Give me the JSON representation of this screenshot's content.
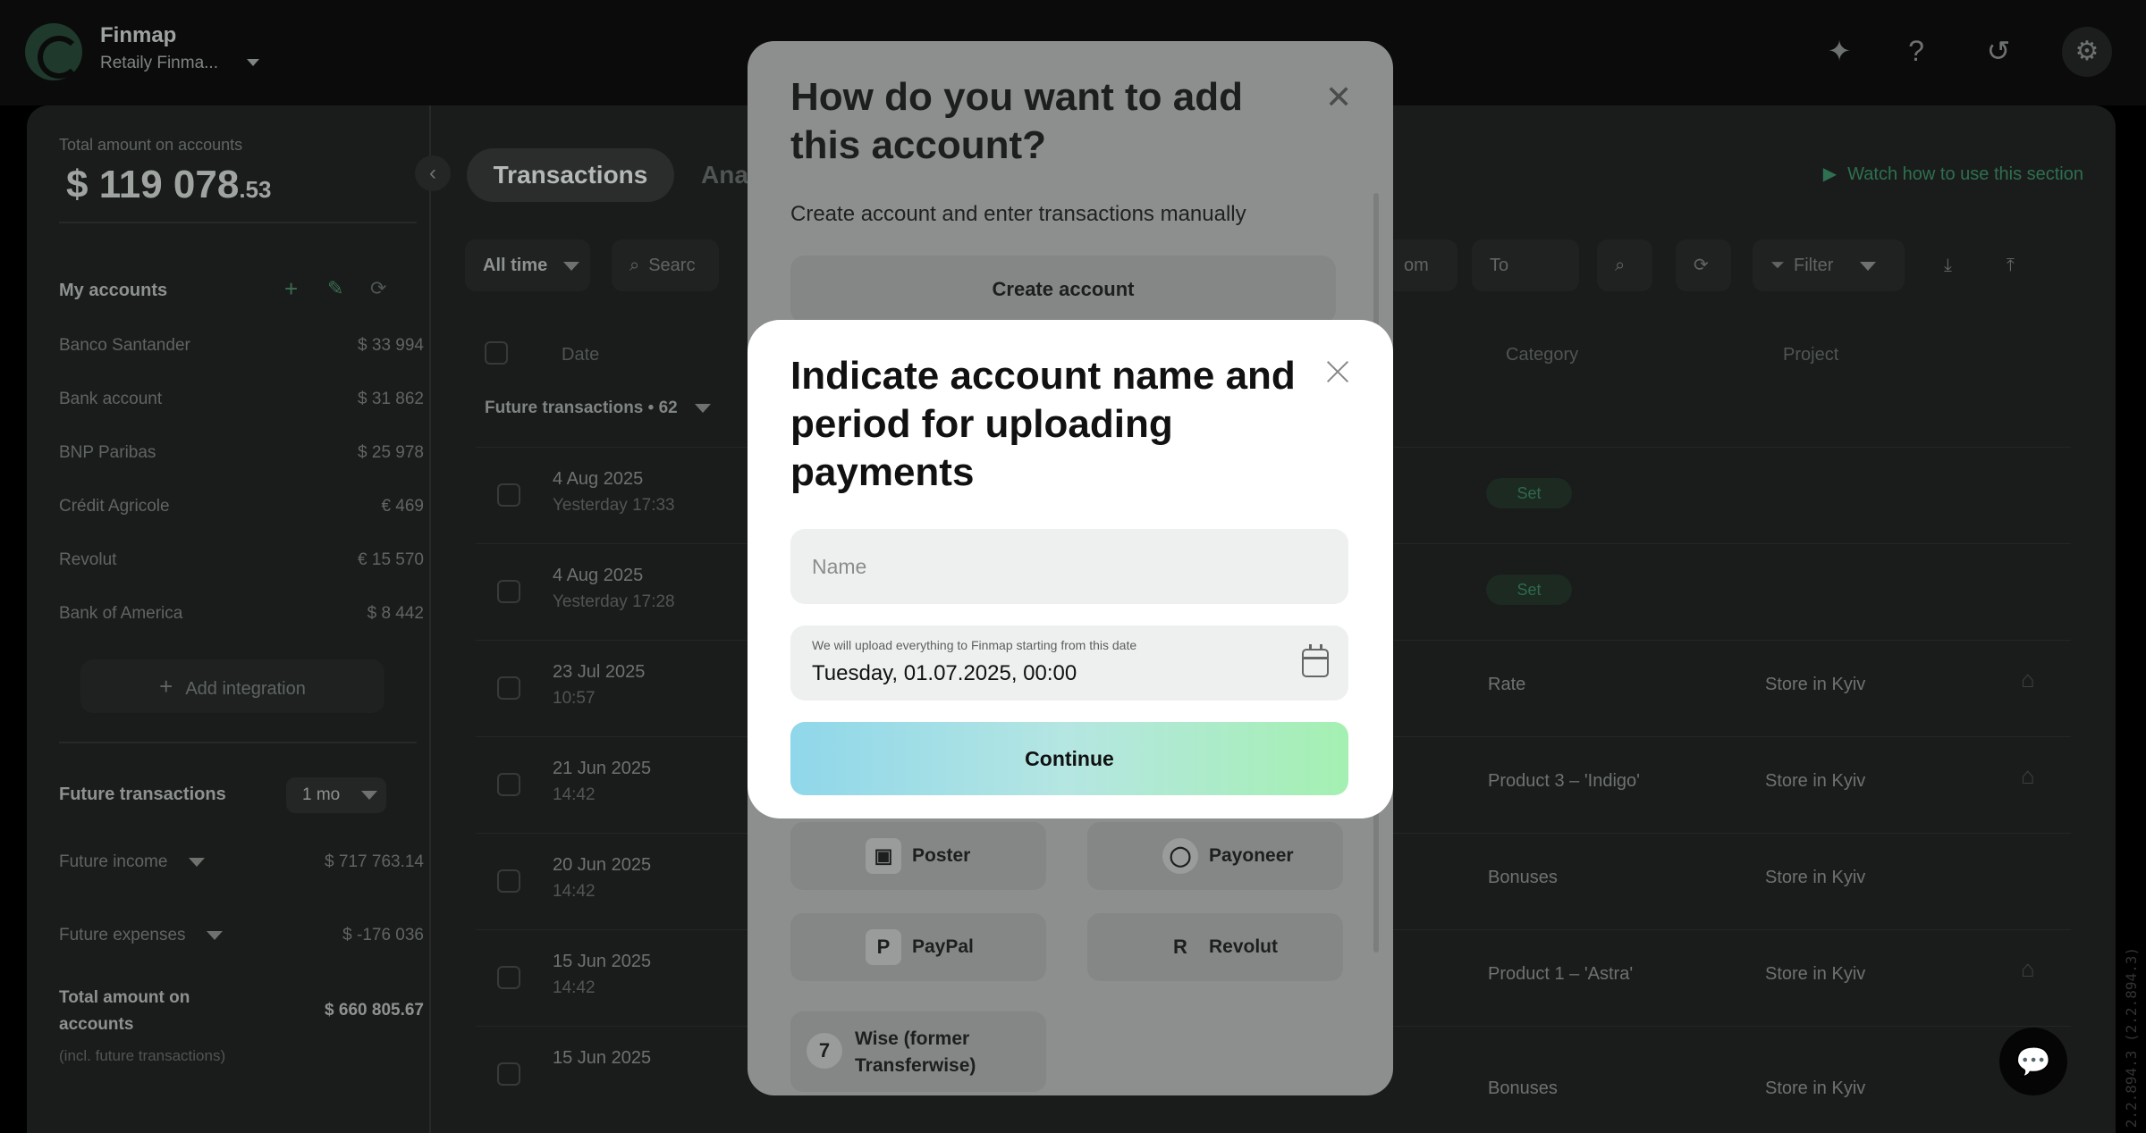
{
  "app": {
    "name": "Finmap",
    "company": "Retaily Finma..."
  },
  "sidebar": {
    "total_label": "Total amount on accounts",
    "total_main": "$ 119 078",
    "total_cents": ".53",
    "accounts_title": "My accounts",
    "accounts": [
      {
        "name": "Banco Santander",
        "amount": "$ 33 994"
      },
      {
        "name": "Bank account",
        "amount": "$ 31 862"
      },
      {
        "name": "BNP Paribas",
        "amount": "$ 25 978"
      },
      {
        "name": "Crédit Agricole",
        "amount": "€ 469"
      },
      {
        "name": "Revolut",
        "amount": "€ 15 570"
      },
      {
        "name": "Bank of America",
        "amount": "$ 8 442"
      }
    ],
    "add_integration": "Add integration",
    "future_title": "Future transactions",
    "future_period": "1 mo",
    "future_income_label": "Future income",
    "future_income_value": "$ 717 763.14",
    "future_expenses_label": "Future expenses",
    "future_expenses_value": "$ -176 036",
    "grand_label": "Total amount on accounts",
    "grand_value": "$ 660 805.67",
    "grand_note": "(incl. future transactions)"
  },
  "main": {
    "tab_active": "Transactions",
    "tab_other": "Ana",
    "watch_label": "Watch how to use this section",
    "period": "All time",
    "search_placeholder": "Searc",
    "from_placeholder": "om",
    "to_placeholder": "To",
    "filter_label": "Filter",
    "headers": {
      "date": "Date",
      "category": "Category",
      "project": "Project"
    },
    "group_label": "Future transactions • 62",
    "rows": [
      {
        "date": "4 Aug 2025",
        "time": "Yesterday 17:33",
        "category": "",
        "project": "",
        "set": "Set"
      },
      {
        "date": "4 Aug 2025",
        "time": "Yesterday 17:28",
        "category": "",
        "project": "",
        "set": "Set"
      },
      {
        "date": "23 Jul 2025",
        "time": "10:57",
        "category": "Rate",
        "project": "Store in Kyiv",
        "set": ""
      },
      {
        "date": "21 Jun 2025",
        "time": "14:42",
        "category": "Product 3 – 'Indigo'",
        "project": "Store in Kyiv",
        "set": ""
      },
      {
        "date": "20 Jun 2025",
        "time": "14:42",
        "category": "Bonuses",
        "project": "Store in Kyiv",
        "set": ""
      },
      {
        "date": "15 Jun 2025",
        "time": "14:42",
        "category": "Product 1 – 'Astra'",
        "project": "Store in Kyiv",
        "set": ""
      },
      {
        "date": "15 Jun 2025",
        "time": "",
        "category": "Bonuses",
        "project": "Store in Kyiv",
        "set": ""
      }
    ]
  },
  "side_code": "2.2.894.3 (2.2.894.3)",
  "back_modal": {
    "title": "How do you want to add this account?",
    "subtitle": "Create account and enter transactions manually",
    "create_button": "Create account",
    "providers": [
      {
        "name": "Poster",
        "icon": "poster-icon"
      },
      {
        "name": "Payoneer",
        "icon": "payoneer-icon"
      },
      {
        "name": "PayPal",
        "icon": "paypal-icon"
      },
      {
        "name": "Revolut",
        "icon": "revolut-icon"
      },
      {
        "name": "Wise (former Transferwise)",
        "icon": "wise-icon"
      }
    ]
  },
  "modal": {
    "title": "Indicate account name and period for uploading payments",
    "name_placeholder": "Name",
    "date_hint": "We will upload everything to Finmap starting from this date",
    "date_value": "Tuesday, 01.07.2025, 00:00",
    "continue_label": "Continue"
  },
  "colors": {
    "accent_green": "#2e7050",
    "continue_gradient_start": "#8fd7ea",
    "continue_gradient_end": "#a4f0b1"
  }
}
